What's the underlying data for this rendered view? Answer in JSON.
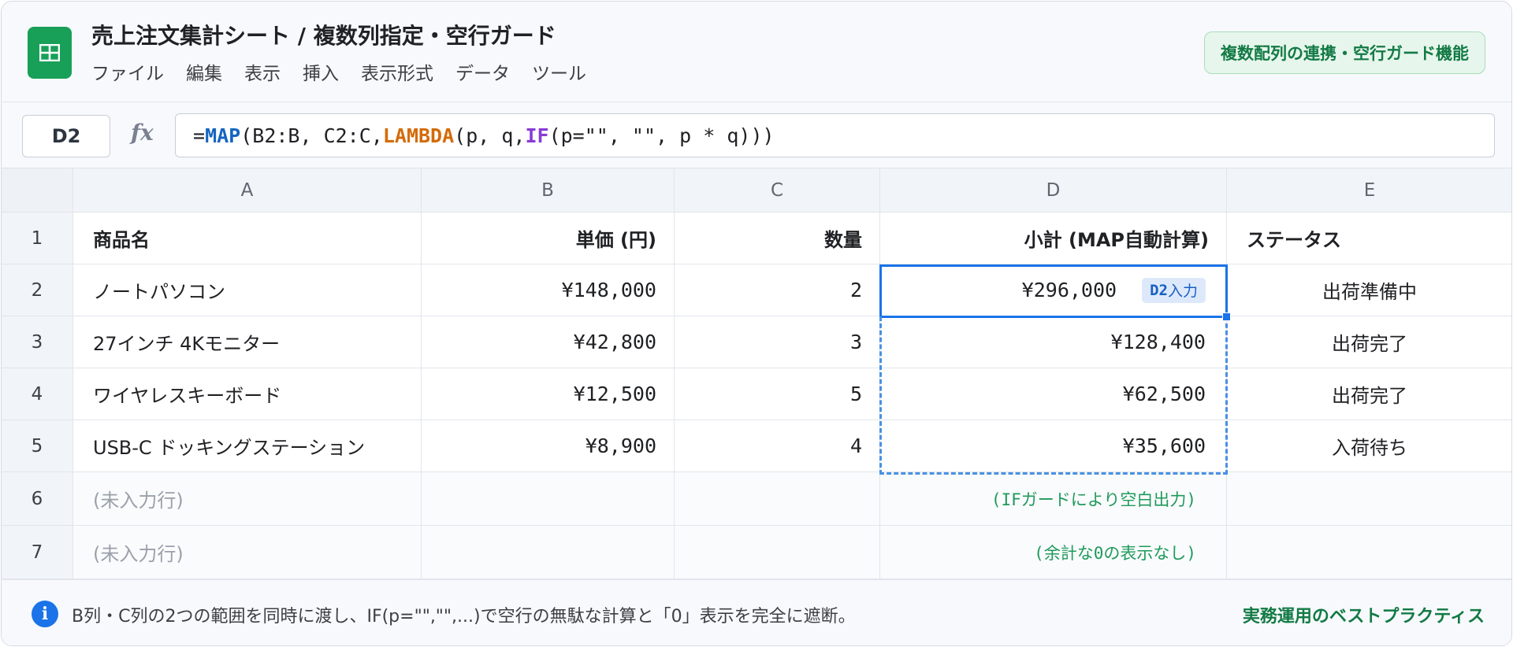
{
  "app": {
    "title": "売上注文集計シート / 複数列指定・空行ガード",
    "feature_badge": "複数配列の連携・空行ガード機能",
    "menu": [
      "ファイル",
      "編集",
      "表示",
      "挿入",
      "表示形式",
      "データ",
      "ツール"
    ]
  },
  "formula_bar": {
    "cell_ref": "D2",
    "fx": "fx",
    "formula": "=MAP(B2:B, C2:C,LAMBDA(p, q,IF(p=\"\", \"\", p * q)))",
    "tokens": {
      "eq": "=",
      "map": "MAP",
      "part1": "(B2:B, C2:C,",
      "lambda": "LAMBDA",
      "part2": "(p, q,",
      "if": "IF",
      "part3": "(p=\"\", \"\", p * q)))"
    }
  },
  "columns": [
    "A",
    "B",
    "C",
    "D",
    "E"
  ],
  "header_row": {
    "num": "1",
    "cells": [
      "商品名",
      "単価 (円)",
      "数量",
      "小計 (MAP自動計算)",
      "ステータス"
    ]
  },
  "rows": [
    {
      "num": "2",
      "name": "ノートパソコン",
      "price": "¥148,000",
      "qty": "2",
      "subtotal": "¥296,000",
      "status": "出荷準備中"
    },
    {
      "num": "3",
      "name": "27インチ 4Kモニター",
      "price": "¥42,800",
      "qty": "3",
      "subtotal": "¥128,400",
      "status": "出荷完了"
    },
    {
      "num": "4",
      "name": "ワイヤレスキーボード",
      "price": "¥12,500",
      "qty": "5",
      "subtotal": "¥62,500",
      "status": "出荷完了"
    },
    {
      "num": "5",
      "name": "USB-C ドッキングステーション",
      "price": "¥8,900",
      "qty": "4",
      "subtotal": "¥35,600",
      "status": "入荷待ち"
    }
  ],
  "empty_rows": [
    {
      "num": "6",
      "name": "(未入力行)",
      "note": "(IFガードにより空白出力)"
    },
    {
      "num": "7",
      "name": "(未入力行)",
      "note": "(余計な0の表示なし)"
    }
  ],
  "active_cell_tag": {
    "ref": "D2",
    "label": "入力"
  },
  "footer": {
    "info": "B列・C列の2つの範囲を同時に渡し、IF(p=\"\",\"\",...)で空行の無駄な計算と「0」表示を完全に遮断。",
    "right": "実務運用のベストプラクティス"
  },
  "colors": {
    "accent": "#1a73e8",
    "brand": "#18a058",
    "success": "#137a45"
  }
}
